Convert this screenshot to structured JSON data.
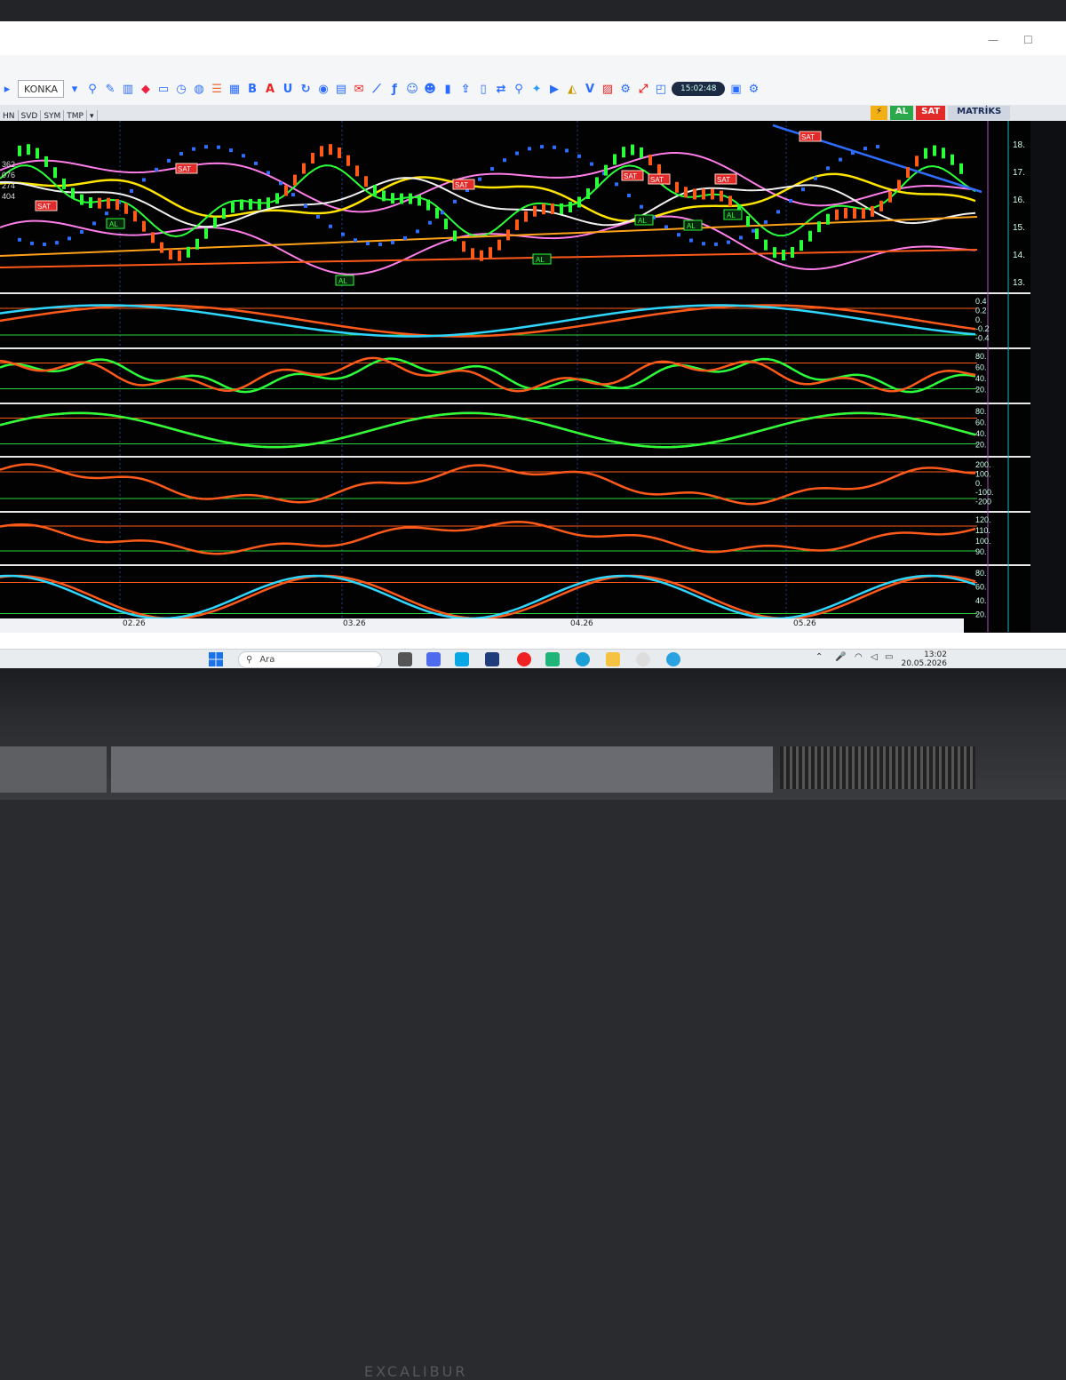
{
  "toolbar": {
    "symbol": "KONKA",
    "time": "15:02:48",
    "icons": [
      "B",
      "A",
      "U"
    ]
  },
  "tabs": [
    "HN",
    "SVD",
    "SYM",
    "TMP"
  ],
  "signals": {
    "al": "AL",
    "sat": "SAT",
    "panel": "MATRİKS"
  },
  "price_axis": [
    "18.",
    "17.",
    "16.",
    "15.",
    "14.",
    "13."
  ],
  "price_left": [
    "362",
    "076",
    "274",
    "404"
  ],
  "osc_axes": [
    [
      "0.4",
      "0.2",
      "0.",
      "-0.2",
      "-0.4"
    ],
    [
      "80.",
      "60.",
      "40.",
      "20."
    ],
    [
      "80.",
      "60.",
      "40.",
      "20."
    ],
    [
      "200.",
      "100.",
      "0.",
      "-100.",
      "-200"
    ],
    [
      "120.",
      "110.",
      "100.",
      "90."
    ],
    [
      "80.",
      "60.",
      "40.",
      "20."
    ]
  ],
  "marker_labels": {
    "sell": "SAT",
    "buy": "AL"
  },
  "dates": [
    "02.26",
    "03.26",
    "04.26",
    "05.26"
  ],
  "taskbar": {
    "search": "Ara",
    "time": "13:02",
    "date": "20.05.2026"
  },
  "brand": "EXCALIBUR",
  "colors": {
    "orange": "#ff5a1a",
    "cyan": "#2fd7ff",
    "green": "#2aff3a",
    "pink": "#ff7de8",
    "yellow": "#ffe400",
    "white": "#f0f0f0",
    "blue": "#2f6dff",
    "gold": "#ffa21a"
  }
}
